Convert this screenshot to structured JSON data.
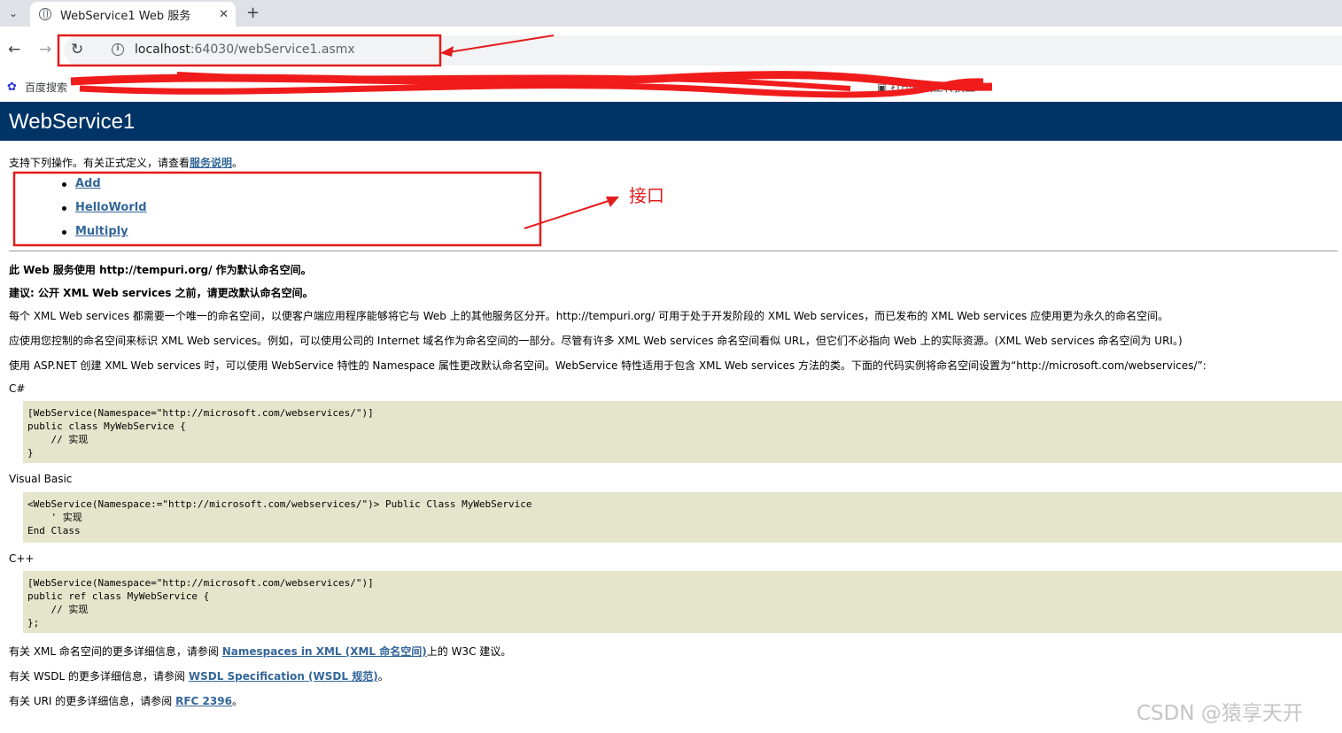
{
  "browser": {
    "tab_title": "WebService1 Web 服务",
    "close_glyph": "✕",
    "new_tab_glyph": "+",
    "menu_glyph": "⌄",
    "back_glyph": "←",
    "forward_glyph": "→",
    "reload_glyph": "↻",
    "url_host": "localhost",
    "url_rest": ":64030/webService1.asmx",
    "info_glyph": "i",
    "bookmark_label": "百度搜索",
    "bookmark_right": "▣ 打印机双工转换工"
  },
  "page": {
    "title": "WebService1",
    "intro_prefix": "支持下列操作。有关正式定义，请查看",
    "intro_link": "服务说明",
    "intro_suffix": "。",
    "operations": [
      "Add",
      "HelloWorld",
      "Multiply"
    ],
    "ns_line1": "此 Web 服务使用 http://tempuri.org/ 作为默认命名空间。",
    "ns_line2": "建议: 公开 XML Web services 之前，请更改默认命名空间。",
    "para1": "每个 XML Web services 都需要一个唯一的命名空间，以便客户端应用程序能够将它与 Web 上的其他服务区分开。http://tempuri.org/ 可用于处于开发阶段的 XML Web services，而已发布的 XML Web services 应使用更为永久的命名空间。",
    "para2": "应使用您控制的命名空间来标识 XML Web services。例如，可以使用公司的 Internet 域名作为命名空间的一部分。尽管有许多 XML Web services 命名空间看似 URL，但它们不必指向 Web 上的实际资源。(XML Web services 命名空间为 URI。)",
    "para3": "使用 ASP.NET 创建 XML Web services 时，可以使用 WebService 特性的 Namespace 属性更改默认命名空间。WebService 特性适用于包含 XML Web services 方法的类。下面的代码实例将命名空间设置为“http://microsoft.com/webservices/”:",
    "csharp_label": "C#",
    "csharp_code": "[WebService(Namespace=\"http://microsoft.com/webservices/\")]\npublic class MyWebService {\n    // 实现\n}",
    "vb_label": "Visual Basic",
    "vb_code": "<WebService(Namespace:=\"http://microsoft.com/webservices/\")> Public Class MyWebService\n    ' 实现\nEnd Class",
    "cpp_label": "C++",
    "cpp_code": "[WebService(Namespace=\"http://microsoft.com/webservices/\")]\npublic ref class MyWebService {\n    // 实现\n};",
    "ref1_prefix": "有关 XML 命名空间的更多详细信息，请参阅 ",
    "ref1_link": "Namespaces in XML (XML 命名空间)",
    "ref1_suffix": "上的 W3C 建议。",
    "ref2_prefix": "有关 WSDL 的更多详细信息，请参阅 ",
    "ref2_link": "WSDL Specification (WSDL 规范)",
    "ref2_suffix": "。",
    "ref3_prefix": "有关 URI 的更多详细信息，请参阅 ",
    "ref3_link": "RFC 2396",
    "ref3_suffix": "。"
  },
  "annotations": {
    "interface_label": "接口",
    "color": "#e31b1b",
    "watermark": "CSDN @猿享天开"
  }
}
